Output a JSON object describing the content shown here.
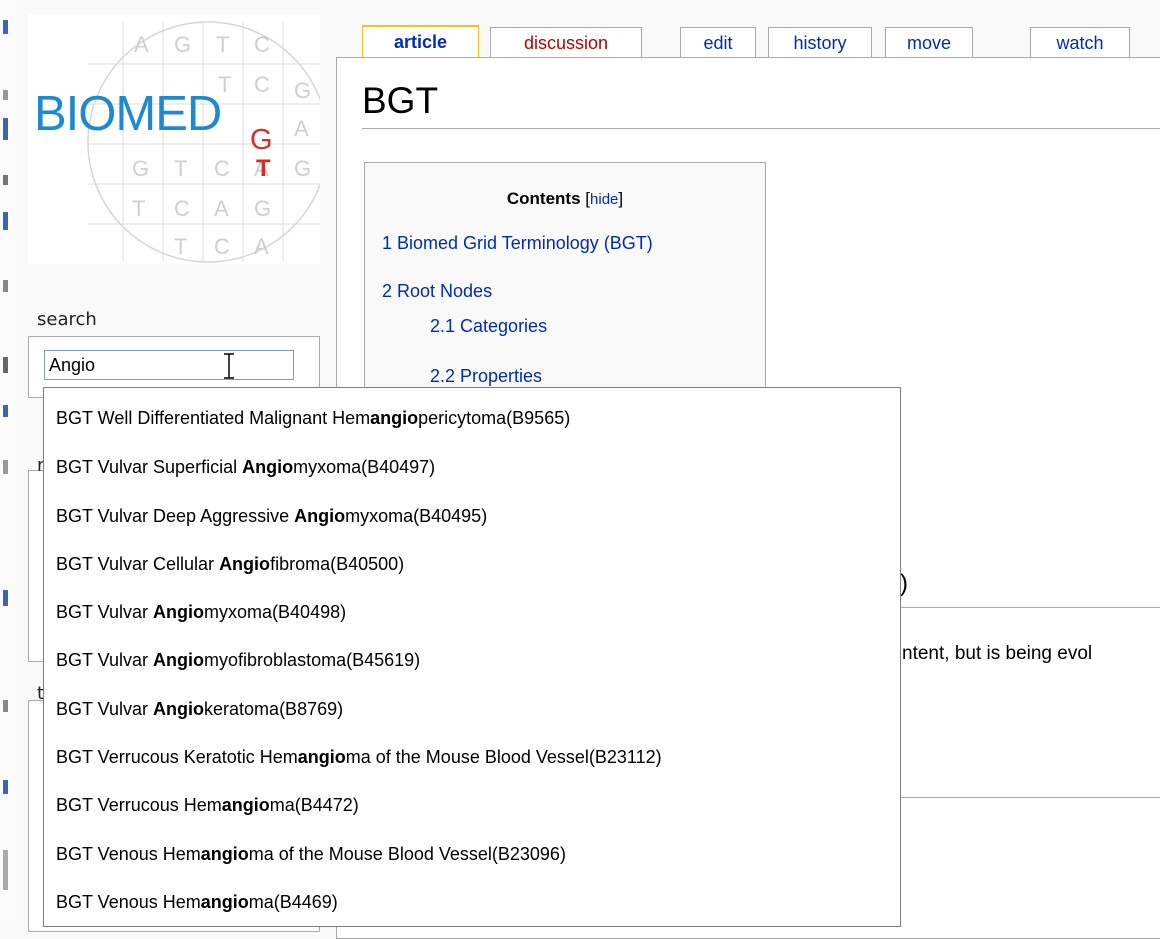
{
  "logo": {
    "text": "BIOMED",
    "subscript": "G",
    "red_letter": "T",
    "grid_letters": [
      "A",
      "G",
      "T",
      "C",
      "T",
      "C",
      "A",
      "G",
      "A",
      "G",
      "T",
      "C",
      "A",
      "G",
      "T",
      "C",
      "A",
      "G",
      "T",
      "C",
      "A"
    ]
  },
  "tabs": [
    {
      "label": "article",
      "state": "selected"
    },
    {
      "label": "discussion",
      "state": "new"
    },
    {
      "label": "edit",
      "state": "normal"
    },
    {
      "label": "history",
      "state": "normal"
    },
    {
      "label": "move",
      "state": "normal"
    },
    {
      "label": "watch",
      "state": "normal"
    }
  ],
  "sidebar": {
    "search_label": "search",
    "search_value": "Angio",
    "portlet_2_label_fragment": "n",
    "portlet_3_label_fragment": "t"
  },
  "page": {
    "title": "BGT",
    "heading_fragment": ")",
    "body_fragment": "ntent, but is being evol"
  },
  "toc": {
    "title": "Contents",
    "hide_label": "hide",
    "items": [
      "1 Biomed Grid Terminology (BGT)",
      "2 Root Nodes",
      "2.1 Categories",
      "2.2 Properties"
    ]
  },
  "suggestions": [
    {
      "pre": "BGT Well Differentiated Malignant Hem",
      "match": "angio",
      "post": "pericytoma(B9565)"
    },
    {
      "pre": "BGT Vulvar Superficial ",
      "match": "Angio",
      "post": "myxoma(B40497)"
    },
    {
      "pre": "BGT Vulvar Deep Aggressive ",
      "match": "Angio",
      "post": "myxoma(B40495)"
    },
    {
      "pre": "BGT Vulvar Cellular ",
      "match": "Angio",
      "post": "fibroma(B40500)"
    },
    {
      "pre": "BGT Vulvar ",
      "match": "Angio",
      "post": "myxoma(B40498)"
    },
    {
      "pre": "BGT Vulvar ",
      "match": "Angio",
      "post": "myofibroblastoma(B45619)"
    },
    {
      "pre": "BGT Vulvar ",
      "match": "Angio",
      "post": "keratoma(B8769)"
    },
    {
      "pre": "BGT Verrucous Keratotic Hem",
      "match": "angio",
      "post": "ma of the Mouse Blood Vessel(B23112)"
    },
    {
      "pre": "BGT Verrucous Hem",
      "match": "angio",
      "post": "ma(B4472)"
    },
    {
      "pre": "BGT Venous Hem",
      "match": "angio",
      "post": "ma of the Mouse Blood Vessel(B23096)"
    },
    {
      "pre": "BGT Venous Hem",
      "match": "angio",
      "post": "ma(B4469)"
    }
  ],
  "colors": {
    "link": "#002bb8",
    "new_link": "#ba0000",
    "logo_blue": "#1c8ad3",
    "logo_red": "#d62b2b",
    "selected_tab_border": "#fabd23"
  }
}
